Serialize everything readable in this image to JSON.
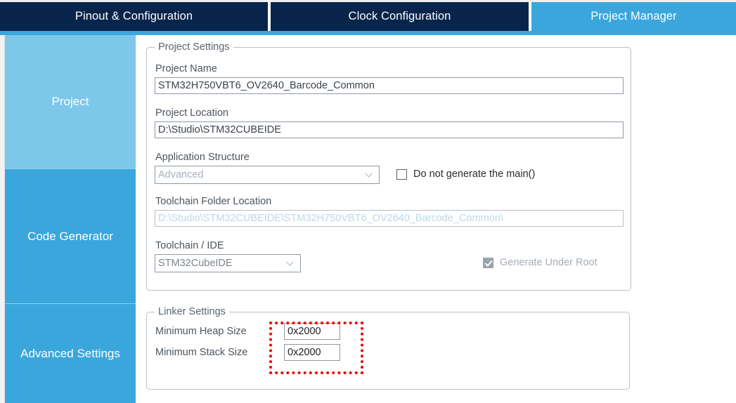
{
  "header": {
    "tabs": [
      {
        "label": "Pinout & Configuration",
        "active": false
      },
      {
        "label": "Clock Configuration",
        "active": false
      },
      {
        "label": "Project Manager",
        "active": true
      }
    ]
  },
  "sidebar": {
    "items": [
      {
        "label": "Project",
        "selected": true
      },
      {
        "label": "Code Generator",
        "selected": false
      },
      {
        "label": "Advanced Settings",
        "selected": false
      }
    ]
  },
  "project_settings": {
    "group_title": "Project Settings",
    "project_name_label": "Project Name",
    "project_name_value": "STM32H750VBT6_OV2640_Barcode_Common",
    "project_location_label": "Project Location",
    "project_location_value": "D:\\Studio\\STM32CUBEIDE",
    "application_structure_label": "Application Structure",
    "application_structure_value": "Advanced",
    "do_not_generate_main_label": "Do not generate the main()",
    "toolchain_folder_label": "Toolchain Folder Location",
    "toolchain_folder_value": "D:\\Studio\\STM32CUBEIDE\\STM32H750VBT6_OV2640_Barcode_Common\\",
    "toolchain_ide_label": "Toolchain / IDE",
    "toolchain_ide_value": "STM32CubeIDE",
    "generate_under_root_label": "Generate Under Root"
  },
  "linker_settings": {
    "group_title": "Linker Settings",
    "min_heap_label": "Minimum Heap Size",
    "min_heap_value": "0x2000",
    "min_stack_label": "Minimum Stack Size",
    "min_stack_value": "0x2000"
  },
  "colors": {
    "tab_inactive": "#09244b",
    "tab_active": "#3aa6dc",
    "sidebar_selected": "#7cc7ea",
    "sidebar_normal": "#3aa6dc",
    "annotation_red": "#ee0000"
  }
}
